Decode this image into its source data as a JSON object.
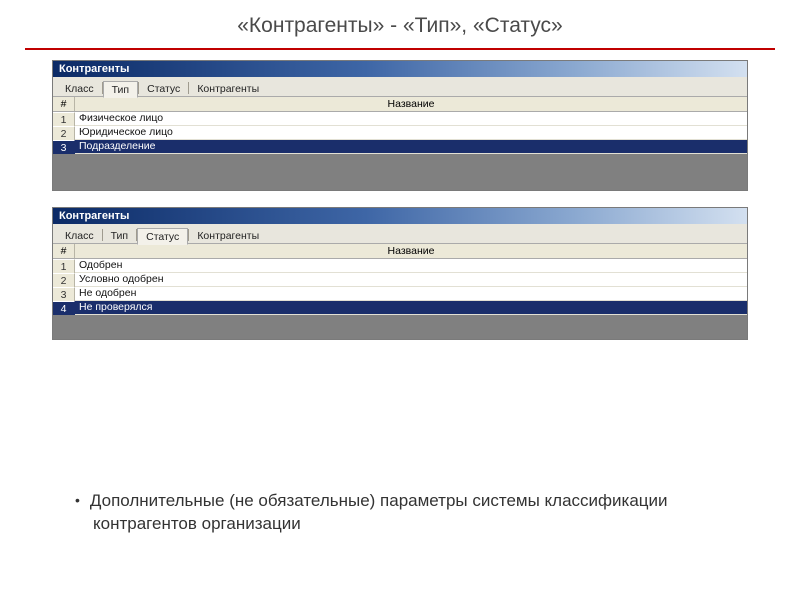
{
  "slide": {
    "title": "«Контрагенты» - «Тип», «Статус»",
    "bullet": "Дополнительные (не обязательные) параметры системы классификации контрагентов организации"
  },
  "panels": [
    {
      "title": "Контрагенты",
      "tabs": [
        {
          "label": "Класс",
          "active": false
        },
        {
          "label": "Тип",
          "active": true
        },
        {
          "label": "Статус",
          "active": false
        },
        {
          "label": "Контрагенты",
          "active": false
        }
      ],
      "columns": {
        "idx": "#",
        "name": "Название"
      },
      "rows": [
        {
          "n": "1",
          "name": "Физическое лицо",
          "selected": false
        },
        {
          "n": "2",
          "name": "Юридическое лицо",
          "selected": false
        },
        {
          "n": "3",
          "name": "Подразделение",
          "selected": true
        }
      ],
      "filler": "large"
    },
    {
      "title": "Контрагенты",
      "tabs": [
        {
          "label": "Класс",
          "active": false
        },
        {
          "label": "Тип",
          "active": false
        },
        {
          "label": "Статус",
          "active": true
        },
        {
          "label": "Контрагенты",
          "active": false
        }
      ],
      "columns": {
        "idx": "#",
        "name": "Название"
      },
      "rows": [
        {
          "n": "1",
          "name": "Одобрен",
          "selected": false
        },
        {
          "n": "2",
          "name": "Условно одобрен",
          "selected": false
        },
        {
          "n": "3",
          "name": "Не одобрен",
          "selected": false
        },
        {
          "n": "4",
          "name": "Не проверялся",
          "selected": true
        }
      ],
      "filler": "small"
    }
  ]
}
